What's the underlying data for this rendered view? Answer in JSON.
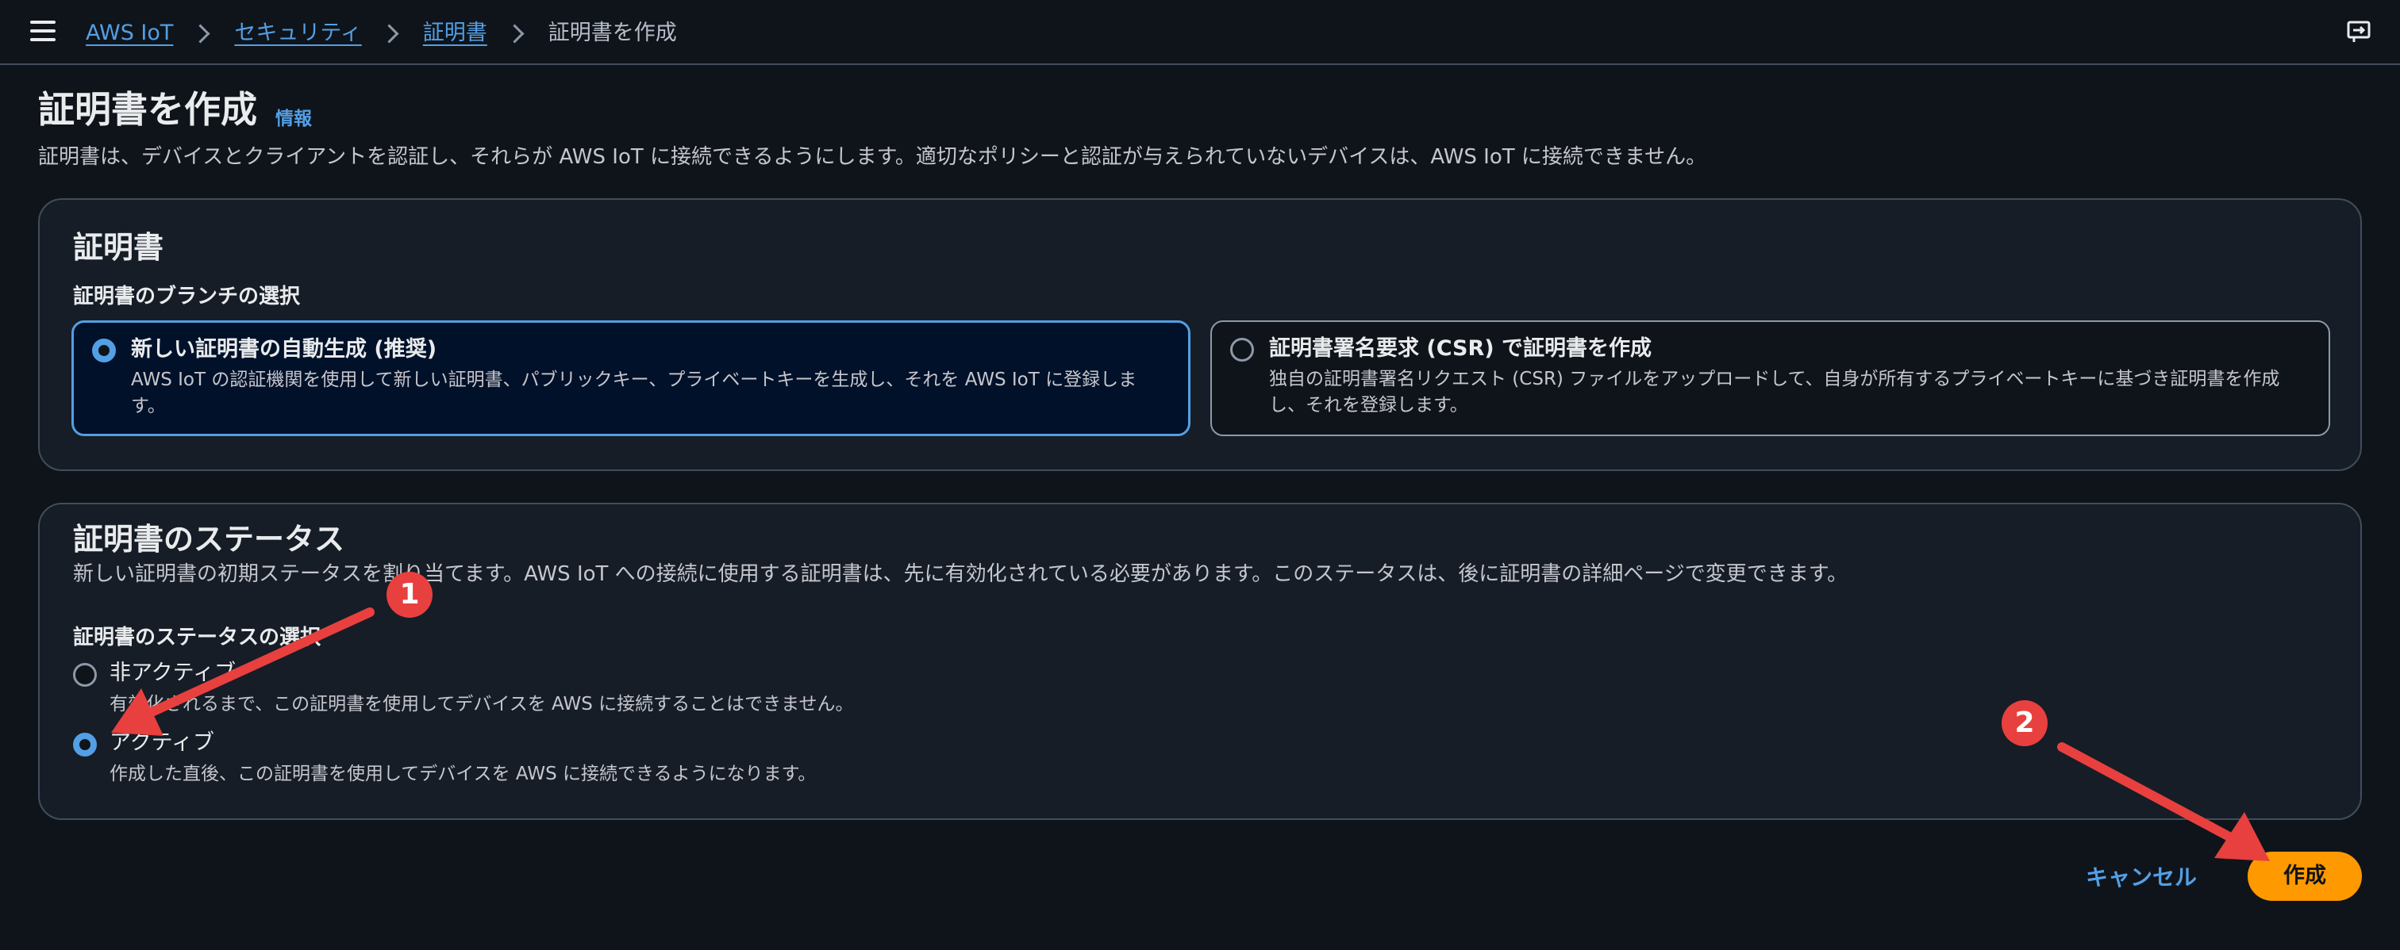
{
  "header": {
    "breadcrumb": [
      {
        "label": "AWS IoT",
        "link": true
      },
      {
        "label": "セキュリティ",
        "link": true
      },
      {
        "label": "証明書",
        "link": true
      },
      {
        "label": "証明書を作成",
        "link": false
      }
    ],
    "menu_icon": "hamburger-icon",
    "help_icon": "help-panel-icon"
  },
  "page": {
    "title": "証明書を作成",
    "info_link": "情報",
    "description": "証明書は、デバイスとクライアントを認証し、それらが AWS IoT に接続できるようにします。適切なポリシーと認証が与えられていないデバイスは、AWS IoT に接続できません。"
  },
  "certificate_panel": {
    "title": "証明書",
    "field_label": "証明書のブランチの選択",
    "options": [
      {
        "label": "新しい証明書の自動生成 (推奨)",
        "description": "AWS IoT の認証機関を使用して新しい証明書、パブリックキー、プライベートキーを生成し、それを AWS IoT に登録します。",
        "selected": true
      },
      {
        "label": "証明書署名要求 (CSR) で証明書を作成",
        "description": "独自の証明書署名リクエスト (CSR) ファイルをアップロードして、自身が所有するプライベートキーに基づき証明書を作成し、それを登録します。",
        "selected": false
      }
    ]
  },
  "status_panel": {
    "title": "証明書のステータス",
    "description": "新しい証明書の初期ステータスを割り当てます。AWS IoT への接続に使用する証明書は、先に有効化されている必要があります。このステータスは、後に証明書の詳細ページで変更できます。",
    "field_label": "証明書のステータスの選択",
    "options": [
      {
        "label": "非アクティブ",
        "description": "有効化されるまで、この証明書を使用してデバイスを AWS に接続することはできません。",
        "selected": false
      },
      {
        "label": "アクティブ",
        "description": "作成した直後、この証明書を使用してデバイスを AWS に接続できるようになります。",
        "selected": true
      }
    ]
  },
  "footer": {
    "cancel_label": "キャンセル",
    "create_label": "作成"
  },
  "annotations": {
    "badges": [
      "1",
      "2"
    ],
    "color": "#e8403e"
  }
}
